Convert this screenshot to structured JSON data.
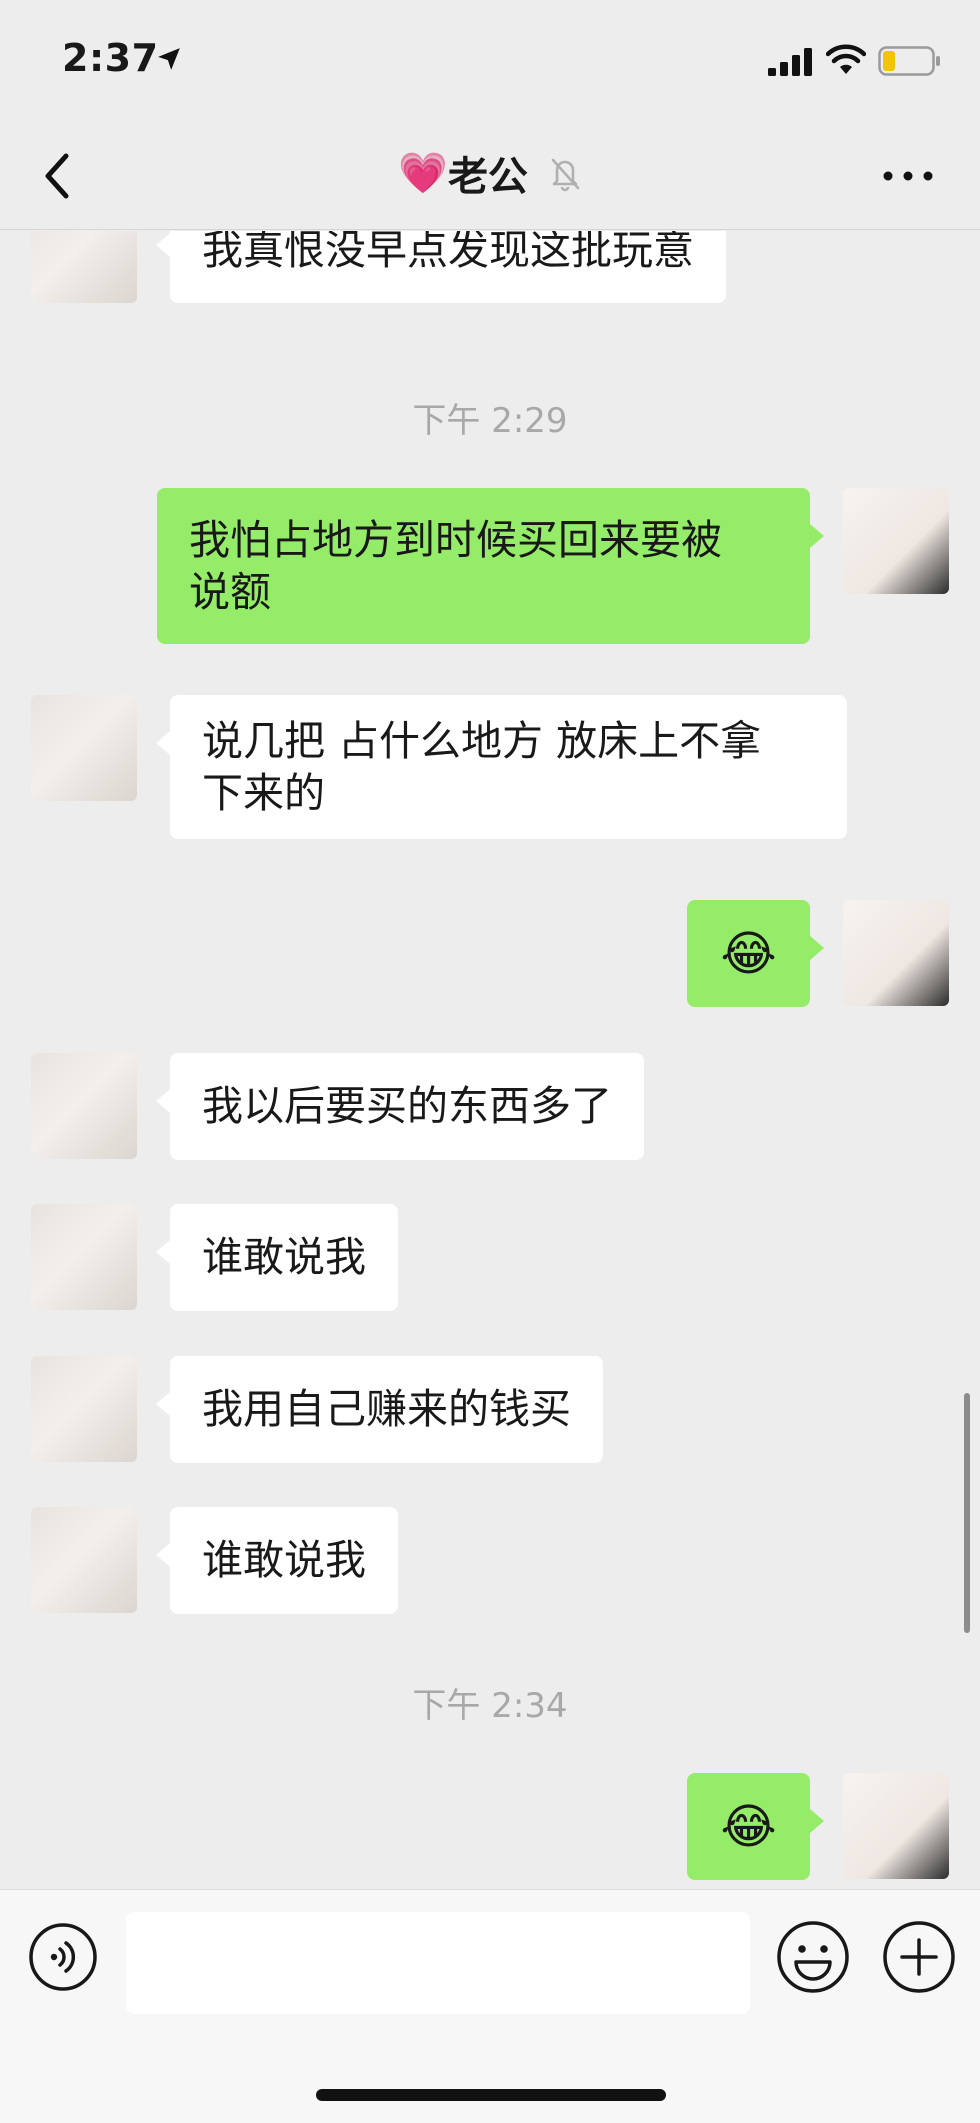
{
  "status": {
    "time": "2:37"
  },
  "nav": {
    "title": "老公",
    "title_emoji": "💗"
  },
  "messages": [
    {
      "side": "left",
      "text": "我真恨没早点发现这批玩意"
    },
    {
      "type": "time",
      "text": "下午 2:29"
    },
    {
      "side": "right",
      "lines": [
        "我怕占地方到时候买回来要被",
        "说额"
      ]
    },
    {
      "side": "left",
      "lines": [
        "说几把 占什么地方 放床上不拿",
        "下来的"
      ]
    },
    {
      "side": "right",
      "emoji": "😂"
    },
    {
      "side": "left",
      "text": "我以后要买的东西多了"
    },
    {
      "side": "left",
      "text": "谁敢说我"
    },
    {
      "side": "left",
      "text": "我用自己赚来的钱买"
    },
    {
      "side": "left",
      "text": "谁敢说我"
    },
    {
      "type": "time",
      "text": "下午 2:34"
    },
    {
      "side": "right",
      "emoji": "😂"
    }
  ],
  "input": {
    "value": ""
  },
  "icons": {
    "back": "chevron-left-icon",
    "mute": "bell-off-icon",
    "more": "more-dots-icon",
    "voice": "voice-icon",
    "emoji": "emoji-face-icon",
    "plus": "plus-icon"
  },
  "colors": {
    "background": "#ededed",
    "sent_bubble": "#95ec69",
    "received_bubble": "#ffffff",
    "timestamp": "#a8a8a8"
  }
}
